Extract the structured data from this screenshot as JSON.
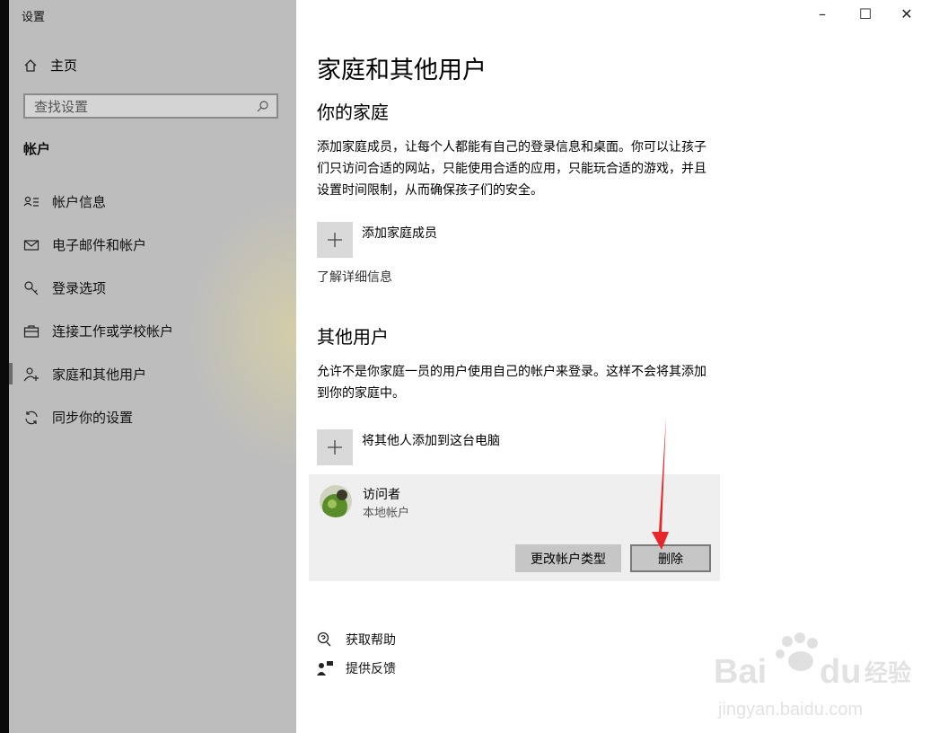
{
  "window": {
    "title": "设置",
    "controls": [
      "–",
      "☐",
      "✕"
    ]
  },
  "sidebar": {
    "home_label": "主页",
    "search_placeholder": "查找设置",
    "section": "帐户",
    "items": [
      {
        "label": "帐户信息",
        "icon": "account-info-icon"
      },
      {
        "label": "电子邮件和帐户",
        "icon": "mail-icon"
      },
      {
        "label": "登录选项",
        "icon": "key-icon"
      },
      {
        "label": "连接工作或学校帐户",
        "icon": "briefcase-icon"
      },
      {
        "label": "家庭和其他用户",
        "icon": "person-add-icon",
        "active": true
      },
      {
        "label": "同步你的设置",
        "icon": "sync-icon"
      }
    ]
  },
  "main": {
    "title": "家庭和其他用户",
    "family": {
      "heading": "你的家庭",
      "description": "添加家庭成员，让每个人都能有自己的登录信息和桌面。你可以让孩子们只访问合适的网站，只能使用合适的应用，只能玩合适的游戏，并且设置时间限制，从而确保孩子们的安全。",
      "add_label": "添加家庭成员",
      "learn_more": "了解详细信息"
    },
    "others": {
      "heading": "其他用户",
      "description": "允许不是你家庭一员的用户使用自己的帐户来登录。这样不会将其添加到你的家庭中。",
      "add_label": "将其他人添加到这台电脑",
      "user": {
        "name": "访问者",
        "type": "本地帐户"
      },
      "change_type_label": "更改帐户类型",
      "delete_label": "删除"
    },
    "help": {
      "get_help": "获取帮助",
      "feedback": "提供反馈"
    }
  },
  "watermark": {
    "brand": "Bai du 经验",
    "url": "jingyan.baidu.com"
  },
  "colors": {
    "sidebar_bg": "#bdbdbd",
    "button_bg": "#c6c6c6",
    "card_bg": "#efefef",
    "arrow": "#e8262a"
  }
}
